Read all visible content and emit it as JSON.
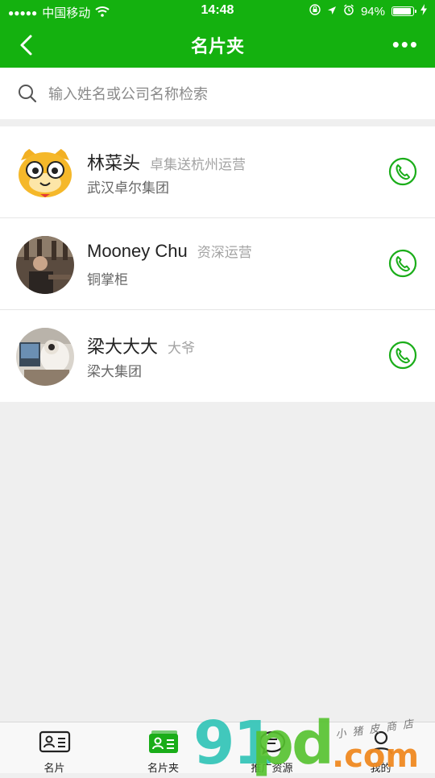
{
  "status_bar": {
    "signal_dots": "●●●●●",
    "carrier": "中国移动",
    "time": "14:48",
    "battery": "94%",
    "battery_level": 0.94
  },
  "nav": {
    "title": "名片夹",
    "more": "•••"
  },
  "search": {
    "placeholder": "输入姓名或公司名称检索",
    "value": ""
  },
  "contacts": [
    {
      "name": "林菜头",
      "role": "卓集送杭州运营",
      "company": "武汉卓尔集团",
      "avatar": "cartoon-cat-avatar"
    },
    {
      "name": "Mooney Chu",
      "role": "资深运营",
      "company": "铜掌柜",
      "avatar": "photo-avatar"
    },
    {
      "name": "梁大大大",
      "role": "大爷",
      "company": "梁大集团",
      "avatar": "photo-avatar"
    }
  ],
  "tabbar": {
    "items": [
      {
        "label": "名片",
        "icon": "card-icon",
        "active": false
      },
      {
        "label": "名片夹",
        "icon": "card-holder-icon",
        "active": true
      },
      {
        "label": "推广资源",
        "icon": "chat-icon",
        "active": false
      },
      {
        "label": "我的",
        "icon": "user-icon",
        "active": false
      }
    ]
  },
  "watermark": {
    "brand_a": "91",
    "brand_b": "pd",
    "domain": ".com",
    "slogan": "小猪皮商店"
  },
  "colors": {
    "primary": "#14b10f",
    "call_icon": "#1aad19",
    "background": "#efefef"
  }
}
